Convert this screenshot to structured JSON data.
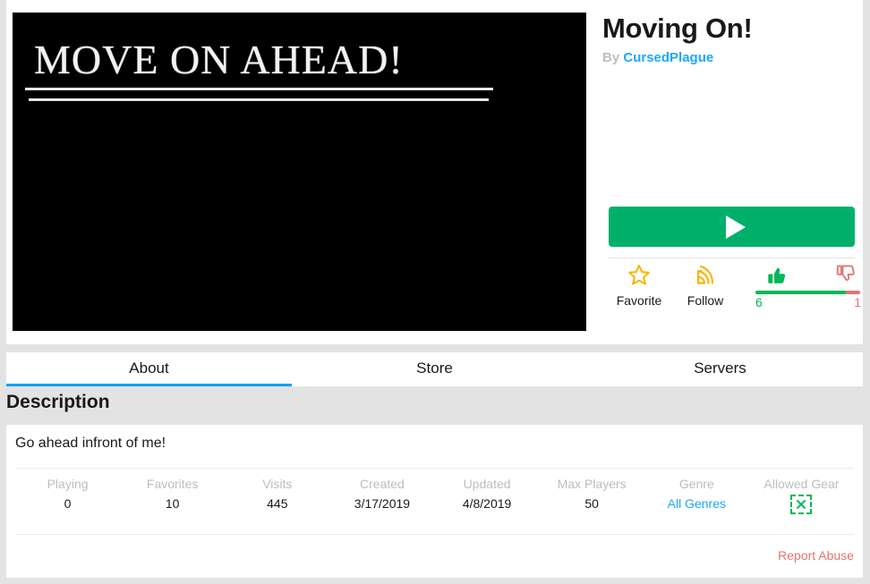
{
  "thumbnail": {
    "alt_text": "MOVE ON AHEAD!",
    "background_color": "#000000",
    "text_color": "#f2f2f2"
  },
  "game": {
    "title": "Moving On!",
    "by_label": "By",
    "author": "CursedPlague",
    "author_color": "#1ca7ff"
  },
  "actions": {
    "play_label": "",
    "play_color": "#00b06a",
    "play_icon": "play-triangle-icon",
    "favorite": {
      "label": "Favorite",
      "icon": "star-outline-icon",
      "color": "#f7b500"
    },
    "follow": {
      "label": "Follow",
      "icon": "rss-follow-icon",
      "color": "#f7b500"
    },
    "votes": {
      "up_icon": "thumbs-up-icon",
      "down_icon": "thumbs-down-icon",
      "up_count": "6",
      "down_count": "1",
      "up_percent": 86,
      "down_percent": 14,
      "up_color": "#02b757",
      "down_color": "#e57373"
    }
  },
  "tabs": [
    {
      "label": "About",
      "active": true
    },
    {
      "label": "Store",
      "active": false
    },
    {
      "label": "Servers",
      "active": false
    }
  ],
  "description": {
    "header": "Description",
    "body": "Go ahead infront of me!"
  },
  "stats": [
    {
      "label": "Playing",
      "value": "0",
      "is_link": false
    },
    {
      "label": "Favorites",
      "value": "10",
      "is_link": false
    },
    {
      "label": "Visits",
      "value": "445",
      "is_link": false
    },
    {
      "label": "Created",
      "value": "3/17/2019",
      "is_link": false
    },
    {
      "label": "Updated",
      "value": "4/8/2019",
      "is_link": false
    },
    {
      "label": "Max Players",
      "value": "50",
      "is_link": false
    },
    {
      "label": "Genre",
      "value": "All Genres",
      "is_link": true
    },
    {
      "label": "Allowed Gear",
      "value": "",
      "is_icon": true,
      "icon": "gear-disallowed-icon"
    }
  ],
  "footer": {
    "report_abuse": "Report Abuse",
    "report_abuse_color": "#e57373"
  }
}
